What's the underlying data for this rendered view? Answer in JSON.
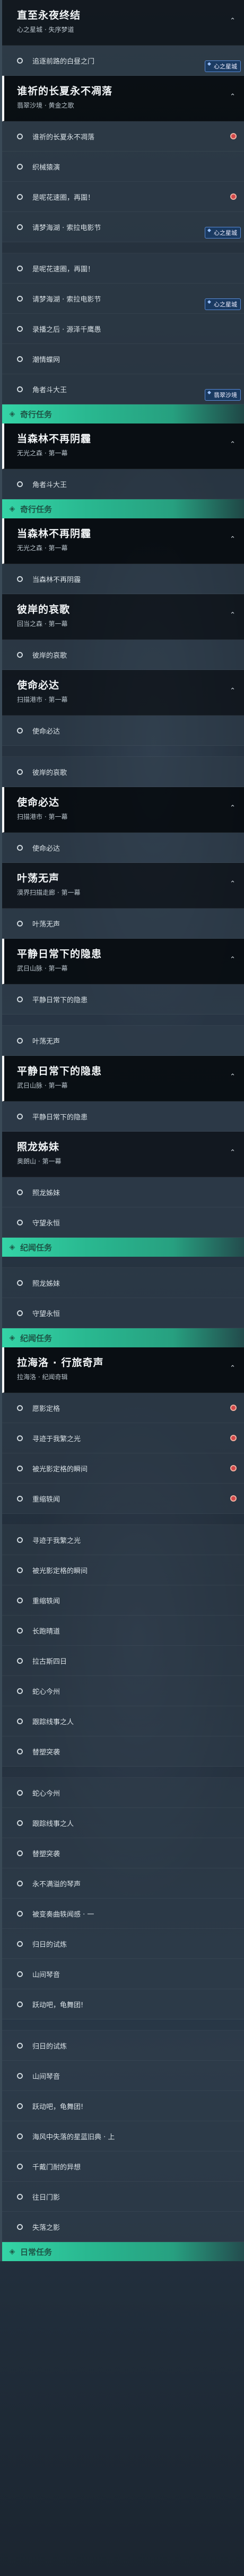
{
  "items": [
    {
      "t": "quest",
      "title": "直至永夜终结",
      "sub": "心之星城 · 失序梦道"
    },
    {
      "t": "step",
      "text": "追逐前路的白昼之门",
      "tag": "心之星城"
    },
    {
      "t": "quest",
      "title": "谁祈的长夏永不凋落",
      "sub": "翡翠沙境 · 黄金之歌",
      "sel": true
    },
    {
      "t": "step",
      "text": "谁祈的长夏永不凋落",
      "dot": true
    },
    {
      "t": "step",
      "text": "织械猿演"
    },
    {
      "t": "step",
      "text": "是呢花速圈，再圍！",
      "dot": true
    },
    {
      "t": "step",
      "text": "请梦海湖 · 索拉电影节",
      "tag": "心之星城"
    },
    {
      "t": "step",
      "text": "",
      "gap": true
    },
    {
      "t": "step",
      "text": "是呢花速圈，再圍！"
    },
    {
      "t": "step",
      "text": "请梦海湖 · 索拉电影节",
      "tag": "心之星城"
    },
    {
      "t": "step",
      "text": "录播之后 · 源泽千鹰愚"
    },
    {
      "t": "step",
      "text": "潮情蝶网"
    },
    {
      "t": "step",
      "text": "角者斗大王",
      "tag": "翡翠沙境"
    },
    {
      "t": "section",
      "text": "奇行任务"
    },
    {
      "t": "quest",
      "title": "当森林不再阴霾",
      "sub": "无光之森 · 第一幕",
      "sel": true
    },
    {
      "t": "step",
      "text": "角者斗大王"
    },
    {
      "t": "section",
      "text": "奇行任务"
    },
    {
      "t": "quest",
      "title": "当森林不再阴霾",
      "sub": "无光之森 · 第一幕",
      "sel": true
    },
    {
      "t": "step",
      "text": "当森林不再阴霾"
    },
    {
      "t": "quest",
      "title": "彼岸的哀歌",
      "sub": "回当之森 · 第一幕"
    },
    {
      "t": "step",
      "text": "彼岸的哀歌"
    },
    {
      "t": "quest",
      "title": "使命必达",
      "sub": "扫描港市 · 第一幕",
      "pin": true
    },
    {
      "t": "step",
      "text": "使命必达"
    },
    {
      "t": "step",
      "text": "",
      "gap": true
    },
    {
      "t": "step",
      "text": "彼岸的哀歌"
    },
    {
      "t": "quest",
      "title": "使命必达",
      "sub": "扫描港市 · 第一幕",
      "sel": true
    },
    {
      "t": "step",
      "text": "使命必达"
    },
    {
      "t": "quest",
      "title": "叶荡无声",
      "sub": "漠界扫描走廊 · 第一幕"
    },
    {
      "t": "step",
      "text": "叶荡无声"
    },
    {
      "t": "quest",
      "title": "平静日常下的隐患",
      "sub": "武日山脉 · 第一幕",
      "sel": true,
      "pin": true
    },
    {
      "t": "step",
      "text": "平静日常下的隐患"
    },
    {
      "t": "step",
      "text": "",
      "gap": true
    },
    {
      "t": "step",
      "text": "叶荡无声"
    },
    {
      "t": "quest",
      "title": "平静日常下的隐患",
      "sub": "武日山脉 · 第一幕",
      "sel": true
    },
    {
      "t": "step",
      "text": "平静日常下的隐患"
    },
    {
      "t": "quest",
      "title": "照龙姊妹",
      "sub": "奥朗山 · 第一幕"
    },
    {
      "t": "step",
      "text": "照龙姊妹"
    },
    {
      "t": "step",
      "text": "守望永恒"
    },
    {
      "t": "section",
      "text": "纪闻任务"
    },
    {
      "t": "step",
      "text": "",
      "gap": true
    },
    {
      "t": "step",
      "text": "照龙姊妹"
    },
    {
      "t": "step",
      "text": "守望永恒"
    },
    {
      "t": "section",
      "text": "纪闻任务"
    },
    {
      "t": "quest",
      "title": "拉海洛 · 行旅奇声",
      "sub": "拉海洛 · 纪闻奇辑",
      "sel": true,
      "pin": true
    },
    {
      "t": "step",
      "text": "愿影定格",
      "dot": true
    },
    {
      "t": "step",
      "text": "寻迹于我繁之光",
      "dot": true
    },
    {
      "t": "step",
      "text": "被光影定格的瞬间",
      "dot": true
    },
    {
      "t": "step",
      "text": "重缩轶闻",
      "dot": true
    },
    {
      "t": "step",
      "text": "",
      "gap": true
    },
    {
      "t": "step",
      "text": "寻迹于我繁之光"
    },
    {
      "t": "step",
      "text": "被光影定格的瞬间"
    },
    {
      "t": "step",
      "text": "重缩轶闻"
    },
    {
      "t": "step",
      "text": "长跑晴道"
    },
    {
      "t": "step",
      "text": "拉古斯四日"
    },
    {
      "t": "step",
      "text": "蛇心今州"
    },
    {
      "t": "step",
      "text": "跟踪线事之人"
    },
    {
      "t": "step",
      "text": "替塑突袭"
    },
    {
      "t": "step",
      "text": "",
      "gap": true
    },
    {
      "t": "step",
      "text": "蛇心今州"
    },
    {
      "t": "step",
      "text": "跟踪线事之人"
    },
    {
      "t": "step",
      "text": "替塑突袭"
    },
    {
      "t": "step",
      "text": "永不满溢的琴声"
    },
    {
      "t": "step",
      "text": "被变奏曲轶闻感 · 一"
    },
    {
      "t": "step",
      "text": "归日的试炼"
    },
    {
      "t": "step",
      "text": "山间琴音"
    },
    {
      "t": "step",
      "text": "跃动吧，龟舞团!"
    },
    {
      "t": "step",
      "text": "",
      "gap": true
    },
    {
      "t": "step",
      "text": "归日的试炼"
    },
    {
      "t": "step",
      "text": "山间琴音"
    },
    {
      "t": "step",
      "text": "跃动吧，龟舞团!"
    },
    {
      "t": "step",
      "text": "海风中失落的星蓝旧典 · 上"
    },
    {
      "t": "step",
      "text": "千戴门耐的异想"
    },
    {
      "t": "step",
      "text": "往日门影"
    },
    {
      "t": "step",
      "text": "失落之影"
    },
    {
      "t": "section",
      "text": "日常任务"
    }
  ]
}
